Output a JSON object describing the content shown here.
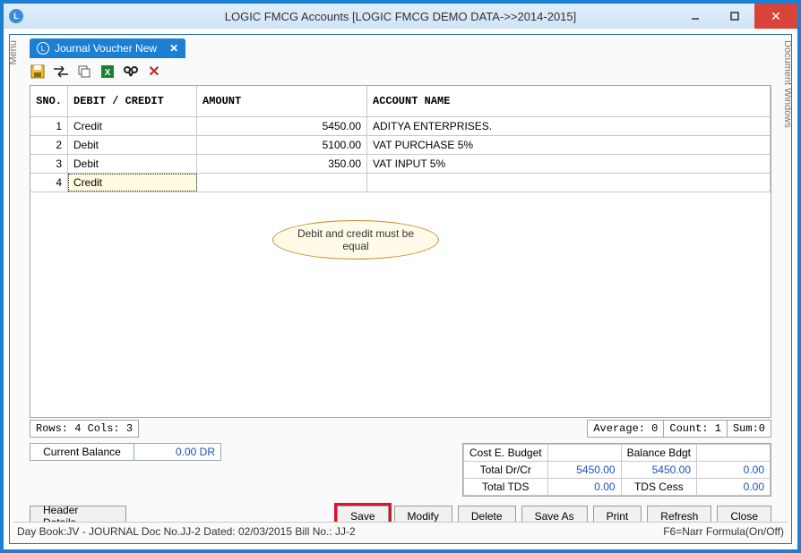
{
  "window": {
    "title": "LOGIC FMCG Accounts  [LOGIC FMCG DEMO DATA->>2014-2015]"
  },
  "side_tabs": {
    "left": "Menu",
    "right": "Document Windows"
  },
  "doc_tab": {
    "title": "Journal Voucher New"
  },
  "grid": {
    "headers": {
      "sno": "SNO.",
      "dc": "DEBIT / CREDIT",
      "amount": "AMOUNT",
      "account": "ACCOUNT NAME"
    },
    "rows": [
      {
        "sno": "1",
        "dc": "Credit",
        "amount": "5450.00",
        "account": "ADITYA ENTERPRISES."
      },
      {
        "sno": "2",
        "dc": "Debit",
        "amount": "5100.00",
        "account": "VAT PURCHASE 5%"
      },
      {
        "sno": "3",
        "dc": "Debit",
        "amount": "350.00",
        "account": "VAT INPUT 5%"
      },
      {
        "sno": "4",
        "dc": "Credit",
        "amount": "",
        "account": ""
      }
    ]
  },
  "callout": "Debit and credit must be equal",
  "stats_left": "Rows: 4 Cols: 3",
  "stats_right": {
    "avg": "Average: 0",
    "count": "Count: 1",
    "sum": "Sum:0"
  },
  "balance": {
    "label": "Current Balance",
    "value": "0.00 DR"
  },
  "budget": {
    "r1c1": "Cost E. Budget",
    "r1c2": "",
    "r1c3": "Balance Bdgt",
    "r1c4": "",
    "r2c1": "Total Dr/Cr",
    "r2c2": "5450.00",
    "r2c3": "5450.00",
    "r2c4": "0.00",
    "r3c1": "Total TDS",
    "r3c2": "0.00",
    "r3c3": "TDS Cess",
    "r3c4": "0.00"
  },
  "buttons": {
    "header_details": "Header Details",
    "save": "Save",
    "modify": "Modify",
    "delete": "Delete",
    "saveas": "Save As",
    "print": "Print",
    "refresh": "Refresh",
    "close": "Close"
  },
  "status": {
    "left": "Day Book:JV - JOURNAL Doc No.JJ-2 Dated: 02/03/2015 Bill No.: JJ-2",
    "right": "F6=Narr Formula(On/Off)"
  }
}
